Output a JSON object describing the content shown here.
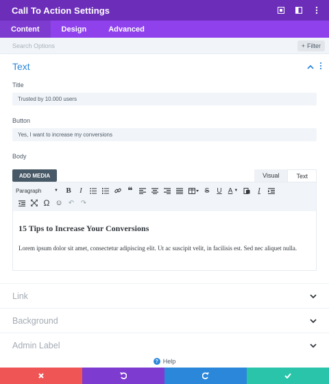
{
  "header": {
    "title": "Call To Action Settings",
    "icons": [
      "expand-icon",
      "split-view-icon",
      "more-icon"
    ]
  },
  "tabs": [
    {
      "label": "Content",
      "active": true
    },
    {
      "label": "Design",
      "active": false
    },
    {
      "label": "Advanced",
      "active": false
    }
  ],
  "search": {
    "placeholder": "Search Options",
    "filter_label": "Filter"
  },
  "text_section": {
    "label": "Text",
    "title_label": "Title",
    "title_value": "Trusted by 10.000 users",
    "button_label": "Button",
    "button_value": "Yes, I want to increase my conversions",
    "body_label": "Body",
    "add_media": "ADD MEDIA",
    "mode_visual": "Visual",
    "mode_text": "Text",
    "format_select": "Paragraph",
    "heading": "15 Tips to Increase Your Conversions",
    "paragraph": "Lorem ipsum dolor sit amet, consectetur adipiscing elit. Ut ac suscipit velit, in facilisis est. Sed nec aliquet nulla."
  },
  "collapsed_sections": [
    {
      "label": "Link"
    },
    {
      "label": "Background"
    },
    {
      "label": "Admin Label"
    }
  ],
  "help": {
    "label": "Help"
  },
  "colors": {
    "header": "#6c2eb9",
    "tabs": "#8f42ec",
    "accent_blue": "#2b87da",
    "cancel": "#ef5555",
    "undo": "#7e3bd0",
    "redo": "#2b87da",
    "save": "#29c4a9"
  }
}
